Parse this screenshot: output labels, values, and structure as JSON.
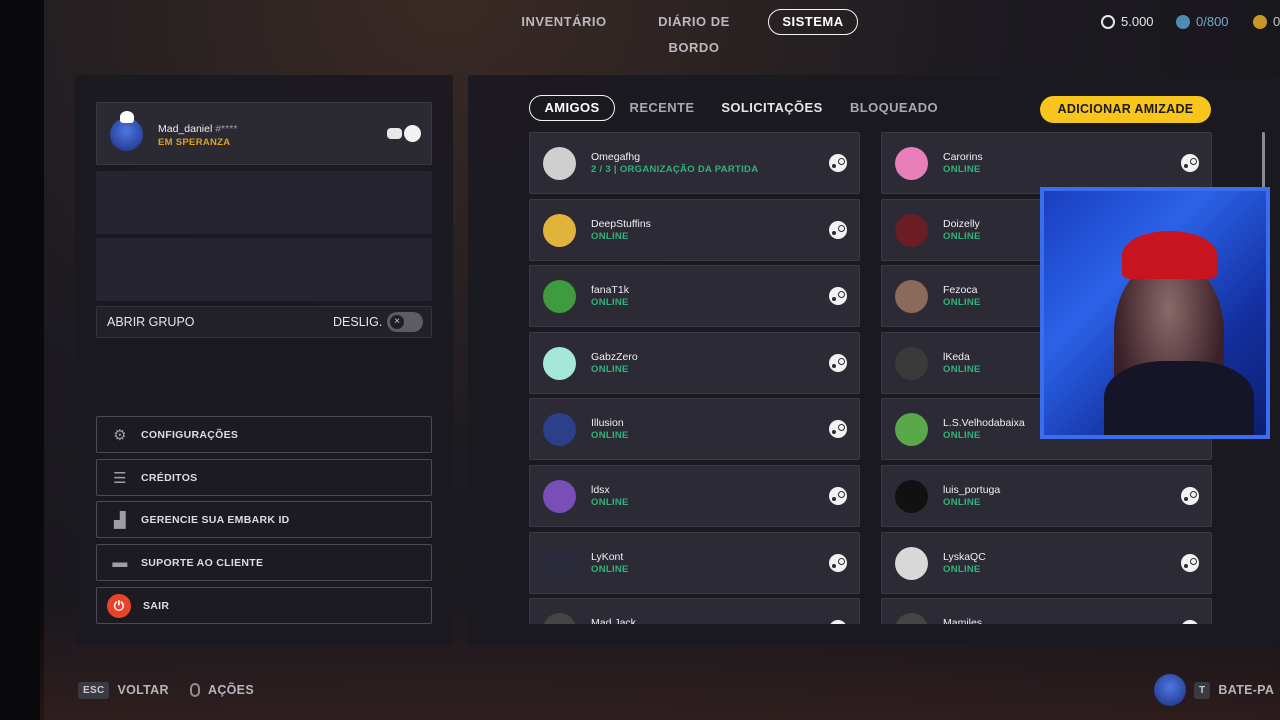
{
  "nav": {
    "tabs": [
      "INVENTÁRIO",
      "DIÁRIO DE BORDO",
      "SISTEMA"
    ],
    "active": "SISTEMA",
    "currency_1": "5.000",
    "currency_2": "0/800"
  },
  "profile": {
    "name": "Mad_daniel",
    "tag": "#****",
    "status": "EM SPERANZA"
  },
  "group": {
    "label": "ABRIR GRUPO",
    "toggle_label": "DESLIG."
  },
  "menu": {
    "items": [
      {
        "label": "CONFIGURAÇÕES",
        "icon": "gear-icon"
      },
      {
        "label": "CRÉDITOS",
        "icon": "list-icon"
      },
      {
        "label": "GERENCIE SUA EMBARK ID",
        "icon": "id-icon"
      },
      {
        "label": "SUPORTE AO CLIENTE",
        "icon": "chat-icon"
      },
      {
        "label": "SAIR",
        "icon": "power-icon"
      }
    ]
  },
  "friends": {
    "tabs": [
      "AMIGOS",
      "RECENTE",
      "SOLICITAÇÕES",
      "BLOQUEADO"
    ],
    "active_tab": "AMIGOS",
    "add_label": "ADICIONAR AMIZADE",
    "left": [
      {
        "name": "Omegafhg",
        "status": "2 / 3 | ORGANIZAÇÃO DA PARTIDA",
        "color": "#cfcfcf"
      },
      {
        "name": "DeepStuffins",
        "status": "ONLINE",
        "color": "#e0b33a"
      },
      {
        "name": "fanaT1k",
        "status": "ONLINE",
        "color": "#3f9b3f"
      },
      {
        "name": "GabzZero",
        "status": "ONLINE",
        "color": "#a6e8d8"
      },
      {
        "name": "Illusion",
        "status": "ONLINE",
        "color": "#2b3f8a"
      },
      {
        "name": "ldsx",
        "status": "ONLINE",
        "color": "#7a4fb5"
      },
      {
        "name": "LyKont",
        "status": "ONLINE",
        "color": "#2a2a3a"
      },
      {
        "name": "Mad Jack",
        "status": "",
        "color": "#444"
      }
    ],
    "right": [
      {
        "name": "Carorins",
        "status": "ONLINE",
        "color": "#e87fb8"
      },
      {
        "name": "Doizelly",
        "status": "ONLINE",
        "color": "#6a1e24"
      },
      {
        "name": "Fezoca",
        "status": "ONLINE",
        "color": "#8a6a5a"
      },
      {
        "name": "lKeda",
        "status": "ONLINE",
        "color": "#3a3a3a"
      },
      {
        "name": "L.S.Velhodabaixa",
        "status": "ONLINE",
        "color": "#5aa848"
      },
      {
        "name": "luis_portuga",
        "status": "ONLINE",
        "color": "#111111"
      },
      {
        "name": "LyskaQC",
        "status": "ONLINE",
        "color": "#d8d8d8"
      },
      {
        "name": "Mamiles",
        "status": "",
        "color": "#444"
      }
    ]
  },
  "bottom": {
    "esc_key": "ESC",
    "back": "VOLTAR",
    "actions": "AÇÕES",
    "t_key": "T",
    "chat": "BATE-PA"
  }
}
